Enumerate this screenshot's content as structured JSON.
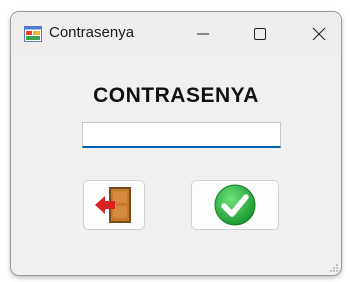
{
  "window": {
    "title": "Contrasenya",
    "app_icon": "forms-icon",
    "controls": [
      {
        "name": "minimize-icon"
      },
      {
        "name": "maximize-icon"
      },
      {
        "name": "close-icon"
      }
    ]
  },
  "form": {
    "heading": "CONTRASENYA",
    "password_value": "",
    "exit_button_icon": "exit-door-icon",
    "ok_button_icon": "checkmark-icon"
  },
  "colors": {
    "accent_underline": "#0063b1",
    "ok_green": "#22b13c",
    "exit_red": "#d92323",
    "door_brown": "#c77a2e"
  }
}
